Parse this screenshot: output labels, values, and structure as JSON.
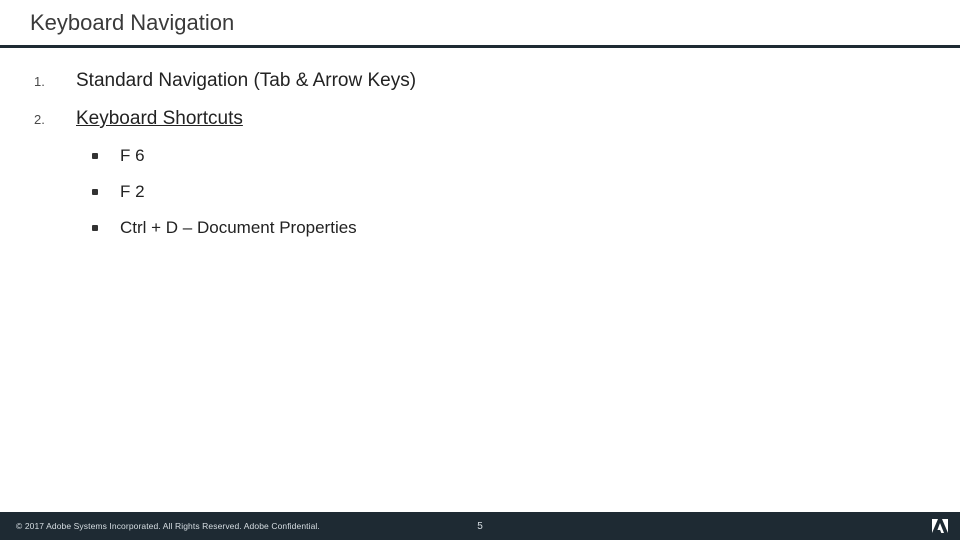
{
  "title": "Keyboard Navigation",
  "numbered": [
    {
      "n": "1.",
      "label": "Standard Navigation (Tab & Arrow Keys)",
      "underline": false
    },
    {
      "n": "2.",
      "label": "Keyboard Shortcuts",
      "underline": true
    }
  ],
  "sub": [
    "F 6",
    "F 2",
    "Ctrl + D – Document Properties"
  ],
  "footer": {
    "copyright": "© 2017 Adobe Systems Incorporated.  All Rights Reserved.  Adobe Confidential.",
    "page": "5"
  }
}
